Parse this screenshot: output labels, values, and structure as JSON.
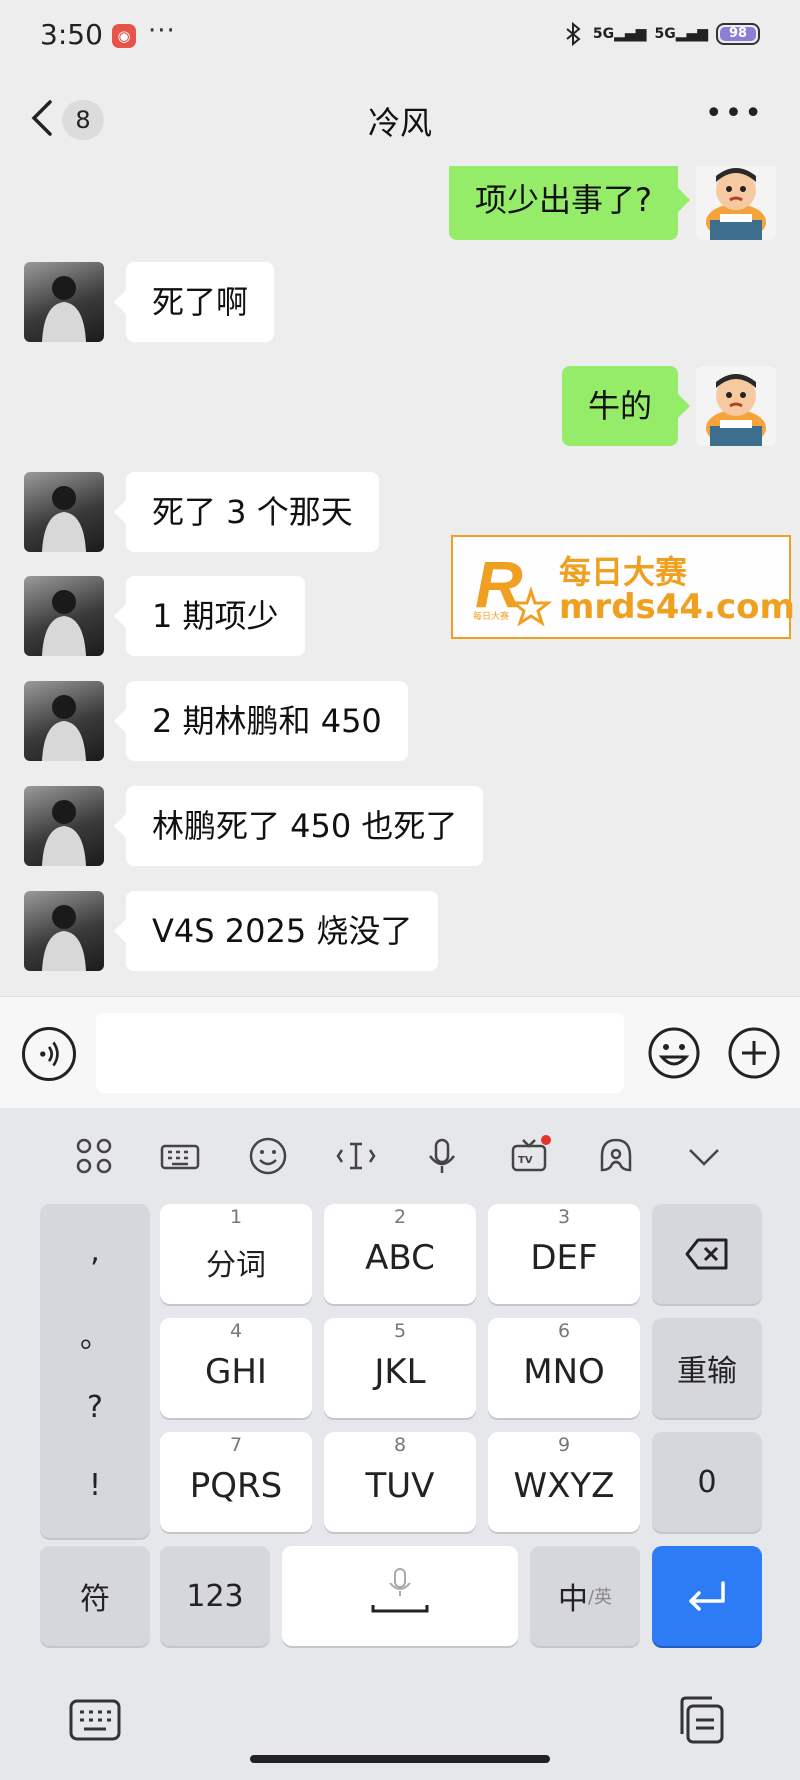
{
  "status_bar": {
    "time": "3:50",
    "dots": "···",
    "network1": "5G",
    "network2": "5G",
    "battery": "98"
  },
  "header": {
    "unread_count": "8",
    "title": "冷风"
  },
  "messages": [
    {
      "side": "out",
      "text": "项少出事了?"
    },
    {
      "side": "in",
      "text": "死了啊"
    },
    {
      "side": "out",
      "text": "牛的"
    },
    {
      "side": "in",
      "text": "死了 3 个那天"
    },
    {
      "side": "in",
      "text": "1 期项少"
    },
    {
      "side": "in",
      "text": "2 期林鹏和 450"
    },
    {
      "side": "in",
      "text": "林鹏死了 450 也死了"
    },
    {
      "side": "in",
      "text": "V4S 2025 烧没了"
    }
  ],
  "watermark": {
    "logo_letter": "R",
    "logo_small": "每日大赛",
    "name": "每日大赛",
    "url": "mrds44.com"
  },
  "keyboard": {
    "keys": [
      {
        "num": "1",
        "label": "分词"
      },
      {
        "num": "2",
        "label": "ABC"
      },
      {
        "num": "3",
        "label": "DEF"
      },
      {
        "num": "4",
        "label": "GHI"
      },
      {
        "num": "5",
        "label": "JKL"
      },
      {
        "num": "6",
        "label": "MNO"
      },
      {
        "num": "7",
        "label": "PQRS"
      },
      {
        "num": "8",
        "label": "TUV"
      },
      {
        "num": "9",
        "label": "WXYZ"
      }
    ],
    "punctuation": [
      ",",
      "。",
      "?",
      "!"
    ],
    "reenter": "重输",
    "zero": "0",
    "symbols": "符",
    "numbers": "123",
    "lang_main": "中",
    "lang_alt": "/英"
  }
}
